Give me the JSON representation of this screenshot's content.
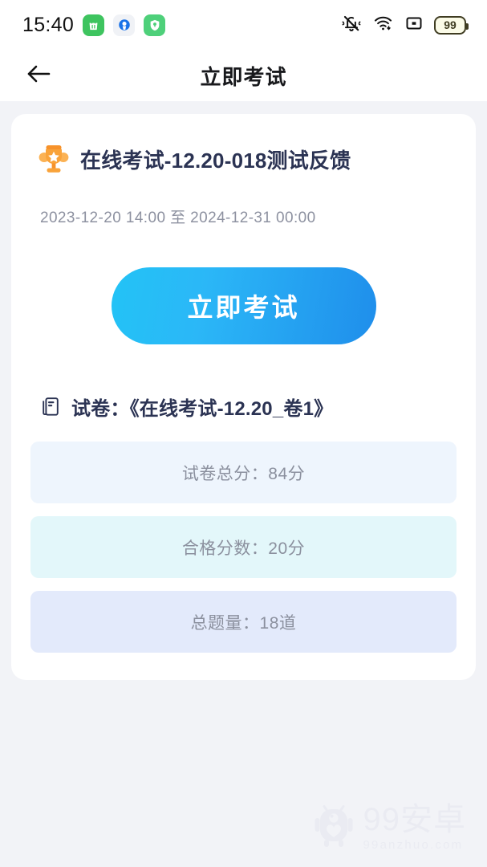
{
  "statusbar": {
    "time": "15:40",
    "app_icons": [
      "shopping-bag-icon",
      "browser-icon",
      "shield-icon"
    ],
    "mute_icon": "bell-mute-icon",
    "wifi_icon": "wifi-icon",
    "signal_icon": "signal-box-icon",
    "battery_level": "99"
  },
  "navbar": {
    "back_icon": "arrow-left-icon",
    "title": "立即考试"
  },
  "exam": {
    "trophy_icon": "trophy-icon",
    "title": "在线考试-12.20-018测试反馈",
    "date_range": "2023-12-20 14:00 至 2024-12-31 00:00",
    "cta_label": "立即考试",
    "paper_icon": "document-icon",
    "paper_label": "试卷：《在线考试-12.20_卷1》",
    "info_rows": [
      {
        "text": "试卷总分：84分"
      },
      {
        "text": "合格分数：20分"
      },
      {
        "text": "总题量：18道"
      }
    ]
  },
  "watermark": {
    "logo_icon": "android-robot-icon",
    "name": "99安卓",
    "site": "99anzhuo.com"
  },
  "colors": {
    "page_bg": "#f2f3f7",
    "card_bg": "#ffffff",
    "title": "#2b3353",
    "muted": "#8d91a0",
    "cta_from": "#23c3f6",
    "cta_to": "#1f8eeb",
    "trophy": "#f79228",
    "row_tints": [
      "#eef5fd",
      "#e3f7fa",
      "#e3eafb"
    ]
  }
}
